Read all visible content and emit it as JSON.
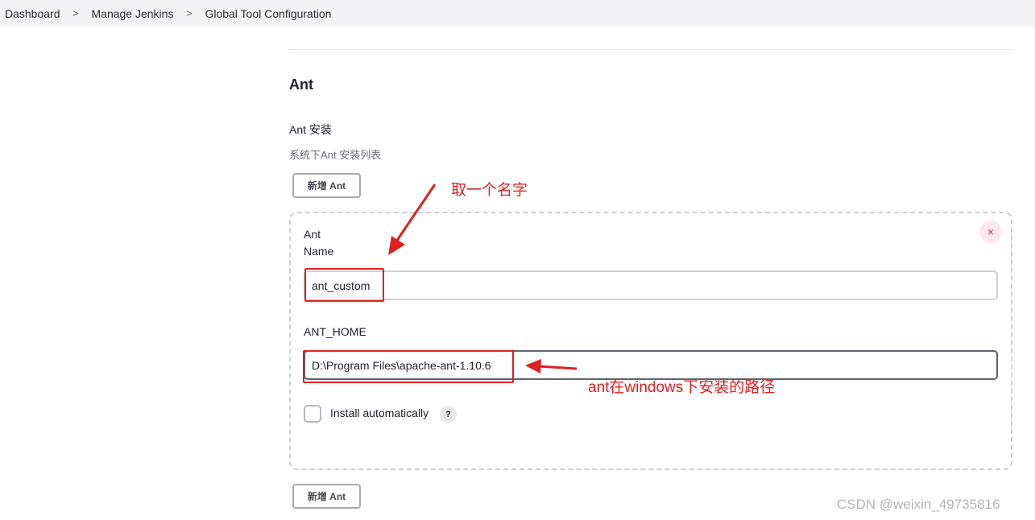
{
  "breadcrumb": [
    "Dashboard",
    "Manage Jenkins",
    "Global Tool Configuration"
  ],
  "breadcrumb_separator": ">",
  "section": {
    "title": "Ant",
    "installations_label": "Ant 安装",
    "installations_desc": "系统下Ant 安装列表",
    "add_button_label": "新增 Ant"
  },
  "tool": {
    "close_label": "×",
    "name_label_line1": "Ant",
    "name_label_line2": "Name",
    "name_value": "ant_custom",
    "home_label": "ANT_HOME",
    "home_value": "D:\\Program Files\\apache-ant-1.10.6",
    "install_auto_label": "Install automatically",
    "install_auto_checked": false,
    "help_label": "?"
  },
  "annotations": {
    "name_hint": "取一个名字",
    "path_hint": "ant在windows下安装的路径",
    "color": "#e02020"
  },
  "watermark": "CSDN @weixin_49735816"
}
